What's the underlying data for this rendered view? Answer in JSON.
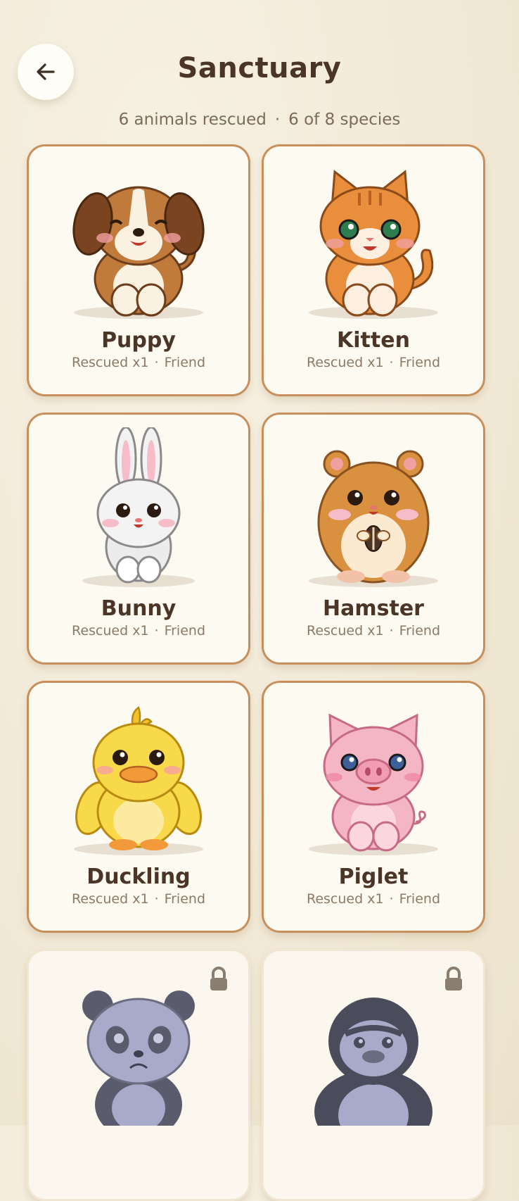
{
  "header": {
    "title": "Sanctuary",
    "rescued": "6 animals rescued",
    "species": "6 of 8 species",
    "separator": "·"
  },
  "animals": [
    {
      "name": "Puppy",
      "rescued": "Rescued x1",
      "status": "Friend",
      "icon": "puppy-icon",
      "locked": false
    },
    {
      "name": "Kitten",
      "rescued": "Rescued x1",
      "status": "Friend",
      "icon": "kitten-icon",
      "locked": false
    },
    {
      "name": "Bunny",
      "rescued": "Rescued x1",
      "status": "Friend",
      "icon": "bunny-icon",
      "locked": false
    },
    {
      "name": "Hamster",
      "rescued": "Rescued x1",
      "status": "Friend",
      "icon": "hamster-icon",
      "locked": false
    },
    {
      "name": "Duckling",
      "rescued": "Rescued x1",
      "status": "Friend",
      "icon": "duckling-icon",
      "locked": false
    },
    {
      "name": "Piglet",
      "rescued": "Rescued x1",
      "status": "Friend",
      "icon": "piglet-icon",
      "locked": false
    },
    {
      "icon": "panda-icon",
      "locked": true
    },
    {
      "icon": "gorilla-icon",
      "locked": true
    }
  ],
  "colors": {
    "accent": "#c78f5c",
    "text": "#4a3526",
    "muted": "#8a7a66",
    "locked": "#8a7e70"
  }
}
